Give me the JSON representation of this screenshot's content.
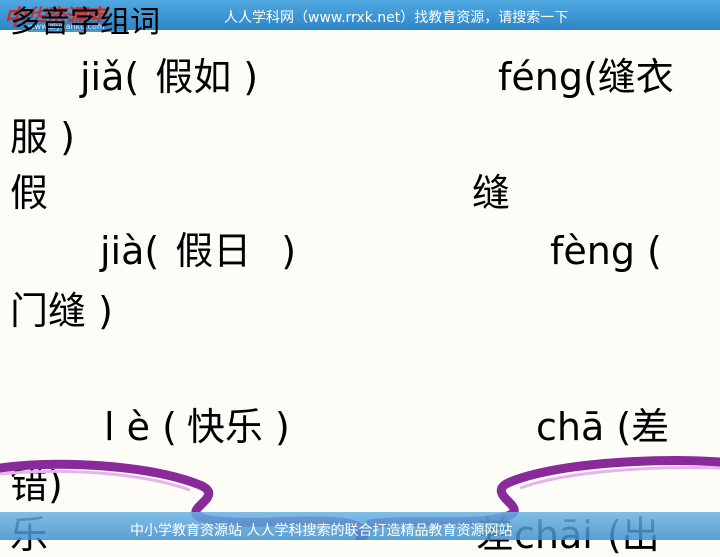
{
  "banner": {
    "logo_text": "中华资源库",
    "logo_url": "www.ziyuanku.com",
    "site_text": "人人学科网（www.rrxk.net）找教育资源，请搜索一下"
  },
  "title": "多音字组词",
  "groups": [
    {
      "char": "假",
      "readings": [
        {
          "pinyin": "jiǎ(",
          "word": "假如",
          "close": ")"
        },
        {
          "pinyin": "jià(",
          "word": "假日",
          "close": ")"
        }
      ]
    },
    {
      "char": "缝",
      "readings": [
        {
          "pinyin": "féng(",
          "word": "缝衣",
          "tail": "服 )"
        },
        {
          "pinyin": "fèng (",
          "word": "",
          "tail": "门缝 )"
        }
      ]
    },
    {
      "char": "乐",
      "readings": [
        {
          "pinyin": "l è (",
          "word": "快乐",
          "close": ")"
        }
      ]
    },
    {
      "char": "差",
      "readings": [
        {
          "pinyin": "chā (",
          "word": "差",
          "tail": "错)"
        },
        {
          "pinyin": "chāi",
          "word": "(出"
        }
      ]
    }
  ],
  "footer": {
    "text": "中小学教育资源站 人人学科搜索的联合打造精品教育资源网站"
  }
}
